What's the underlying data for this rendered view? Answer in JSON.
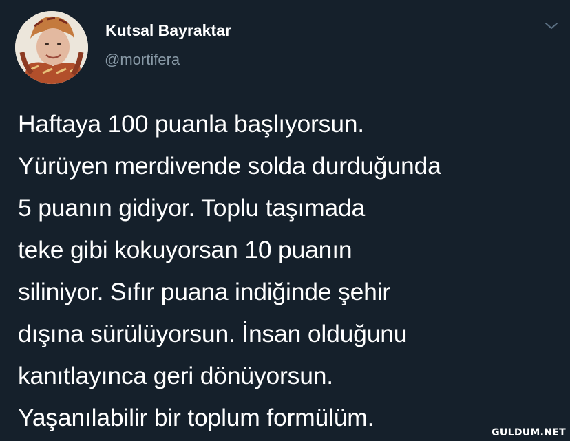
{
  "user": {
    "display_name": "Kutsal Bayraktar",
    "handle": "@mortifera"
  },
  "tweet": {
    "lines": [
      "Haftaya 100 puanla başlıyorsun.",
      "Yürüyen merdivende solda durduğunda",
      "5 puanın gidiyor. Toplu taşımada",
      "teke gibi kokuyorsan 10 puanın",
      "siliniyor. Sıfır puana indiğinde şehir",
      "dışına sürülüyorsun. İnsan olduğunu",
      "kanıtlayınca geri dönüyorsun.",
      "Yaşanılabilir bir toplum formülüm."
    ]
  },
  "watermark": "GULDUM.NET",
  "colors": {
    "background": "#15202b",
    "text": "#ffffff",
    "secondary_text": "#8899a6"
  },
  "icons": {
    "menu": "chevron-down-icon"
  }
}
